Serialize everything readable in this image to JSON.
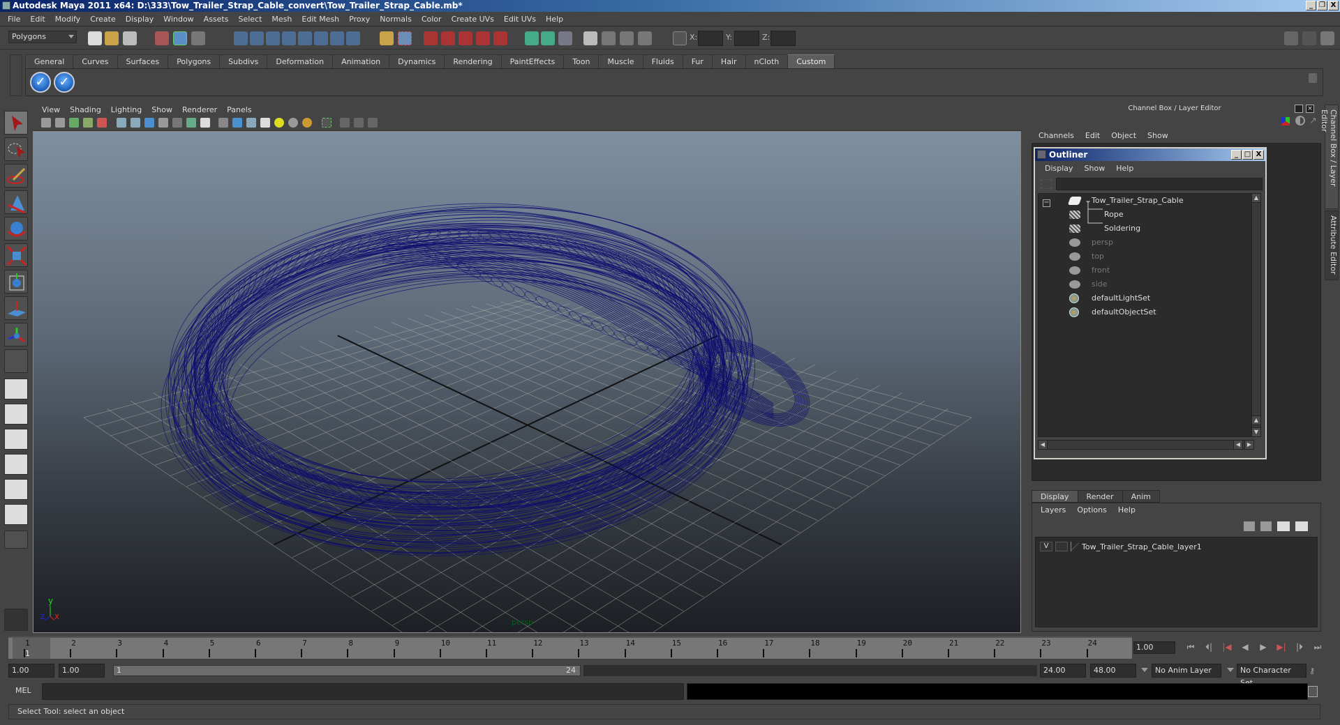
{
  "window": {
    "title": "Autodesk Maya 2011 x64: D:\\333\\Tow_Trailer_Strap_Cable_convert\\Tow_Trailer_Strap_Cable.mb*",
    "controls": [
      "minimize",
      "restore",
      "close"
    ]
  },
  "menubar": [
    "File",
    "Edit",
    "Modify",
    "Create",
    "Display",
    "Window",
    "Assets",
    "Select",
    "Mesh",
    "Edit Mesh",
    "Proxy",
    "Normals",
    "Color",
    "Create UVs",
    "Edit UVs",
    "Help"
  ],
  "statusline": {
    "mode": "Polygons",
    "x_label": "X:",
    "y_label": "Y:",
    "z_label": "Z:",
    "x_value": "",
    "y_value": "",
    "z_value": ""
  },
  "shelf": {
    "tabs": [
      "General",
      "Curves",
      "Surfaces",
      "Polygons",
      "Subdivs",
      "Deformation",
      "Animation",
      "Dynamics",
      "Rendering",
      "PaintEffects",
      "Toon",
      "Muscle",
      "Fluids",
      "Fur",
      "Hair",
      "nCloth",
      "Custom"
    ],
    "active_tab": "Custom",
    "buttons": [
      "check-icon",
      "check-icon"
    ]
  },
  "toolbox": {
    "tools": [
      "select-tool",
      "lasso-tool",
      "paint-select-tool",
      "move-tool",
      "rotate-tool",
      "scale-tool",
      "universal-manipulator",
      "soft-mod-tool",
      "show-manipulator",
      "last-tool"
    ],
    "layouts": [
      "single-perspective",
      "four-view",
      "outliner-persp",
      "persp-graph",
      "hypershade-persp",
      "persp-graph-hypergraph"
    ]
  },
  "viewport": {
    "menu": [
      "View",
      "Shading",
      "Lighting",
      "Show",
      "Renderer",
      "Panels"
    ],
    "camera": "persp",
    "axis": {
      "x": "x",
      "y": "y",
      "z": "z"
    },
    "wireframe_color": "#0c0c6e"
  },
  "channel_box": {
    "header": "Channel Box / Layer Editor",
    "menu": [
      "Channels",
      "Edit",
      "Object",
      "Show"
    ]
  },
  "outliner": {
    "title": "Outliner",
    "menu": [
      "Display",
      "Show",
      "Help"
    ],
    "items": [
      {
        "label": "Tow_Trailer_Strap_Cable",
        "icon": "transform-icon",
        "indent": 0,
        "dim": false
      },
      {
        "label": "Rope",
        "icon": "mesh-icon",
        "indent": 1,
        "dim": false
      },
      {
        "label": "Soldering",
        "icon": "mesh-icon",
        "indent": 1,
        "dim": false
      },
      {
        "label": "persp",
        "icon": "camera-icon",
        "indent": 0,
        "dim": true
      },
      {
        "label": "top",
        "icon": "camera-icon",
        "indent": 0,
        "dim": true
      },
      {
        "label": "front",
        "icon": "camera-icon",
        "indent": 0,
        "dim": true
      },
      {
        "label": "side",
        "icon": "camera-icon",
        "indent": 0,
        "dim": true
      },
      {
        "label": "defaultLightSet",
        "icon": "set-icon",
        "indent": 0,
        "dim": false
      },
      {
        "label": "defaultObjectSet",
        "icon": "set-icon",
        "indent": 0,
        "dim": false
      }
    ]
  },
  "side_tabs": [
    "Channel Box / Layer Editor",
    "Attribute Editor"
  ],
  "layer_editor": {
    "tabs": [
      "Display",
      "Render",
      "Anim"
    ],
    "active_tab": "Display",
    "menu": [
      "Layers",
      "Options",
      "Help"
    ],
    "layers": [
      {
        "visible": "V",
        "name": "Tow_Trailer_Strap_Cable_layer1"
      }
    ]
  },
  "timeline": {
    "ticks": [
      1,
      2,
      3,
      4,
      5,
      6,
      7,
      8,
      9,
      10,
      11,
      12,
      13,
      14,
      15,
      16,
      17,
      18,
      19,
      20,
      21,
      22,
      23,
      24
    ],
    "current_frame_label": "1",
    "current_frame": "1.00"
  },
  "range": {
    "start": "1.00",
    "anim_start": "1.00",
    "slider_start": "1",
    "slider_end": "24",
    "end": "24.00",
    "anim_end": "48.00",
    "anim_layer": "No Anim Layer",
    "character_set": "No Character Set"
  },
  "command_line": {
    "label": "MEL",
    "value": ""
  },
  "help_line": "Select Tool: select an object"
}
